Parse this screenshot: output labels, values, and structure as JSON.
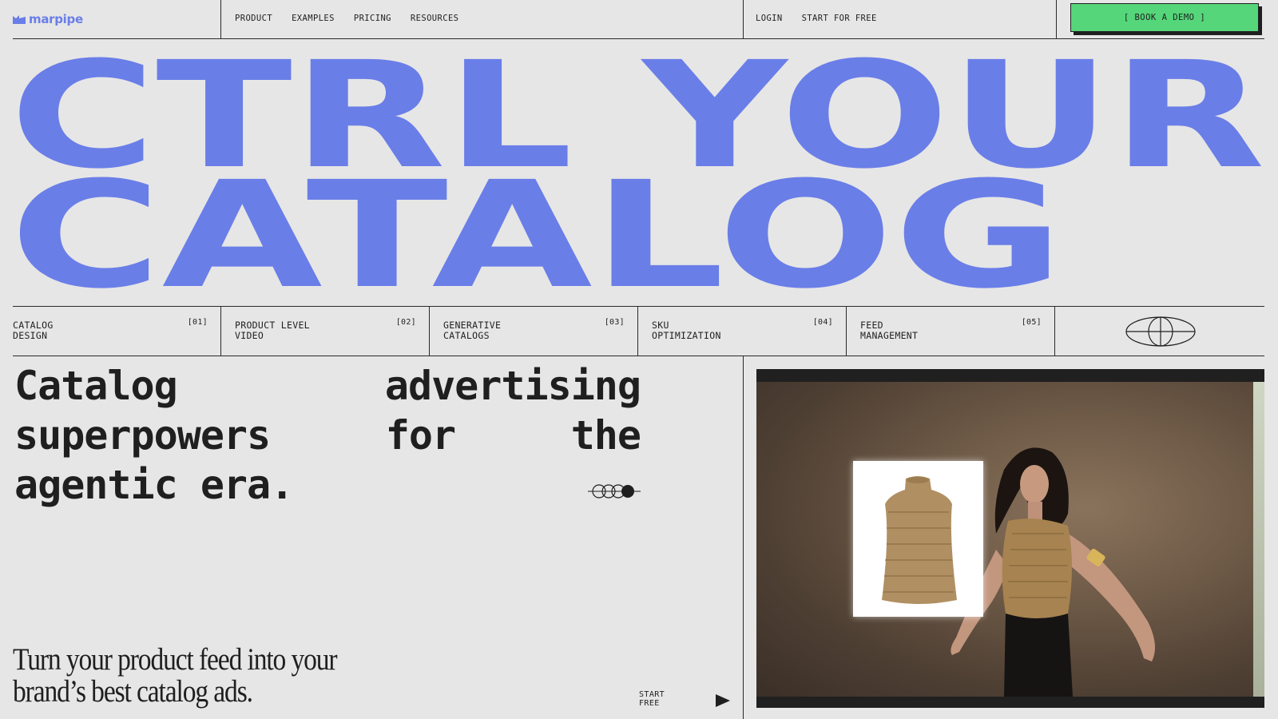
{
  "nav": {
    "logo_text": "marpipe",
    "links": [
      "PRODUCT",
      "EXAMPLES",
      "PRICING",
      "RESOURCES"
    ],
    "login": "LOGIN",
    "start_for_free": "START FOR FREE",
    "demo_button": "[ BOOK A DEMO ]"
  },
  "hero": {
    "line1": "CTRL YOUR",
    "line2": "CATALOG",
    "color": "#6a7ee8"
  },
  "features": [
    {
      "label_line1": "CATALOG",
      "label_line2": "DESIGN",
      "number": "[01]"
    },
    {
      "label_line1": "PRODUCT LEVEL",
      "label_line2": "VIDEO",
      "number": "[02]"
    },
    {
      "label_line1": "GENERATIVE",
      "label_line2": "CATALOGS",
      "number": "[03]"
    },
    {
      "label_line1": "SKU",
      "label_line2": "OPTIMIZATION",
      "number": "[04]"
    },
    {
      "label_line1": "FEED",
      "label_line2": "MANAGEMENT",
      "number": "[05]"
    }
  ],
  "icons": {
    "logo": "marpipe-logo-icon",
    "globe": "globe-icon",
    "circles": "carousel-dots-icon",
    "play": "play-icon"
  },
  "headline": "Catalog advertising superpowers for the agentic era.",
  "tagline": "Turn your product feed into your brand’s best catalog ads.",
  "start_free": {
    "line1": "START",
    "line2": "FREE"
  },
  "colors": {
    "background": "#e6e6e6",
    "accent_blue": "#6a7ee8",
    "cta_green": "#55d67a",
    "ink": "#1f1f1f"
  }
}
